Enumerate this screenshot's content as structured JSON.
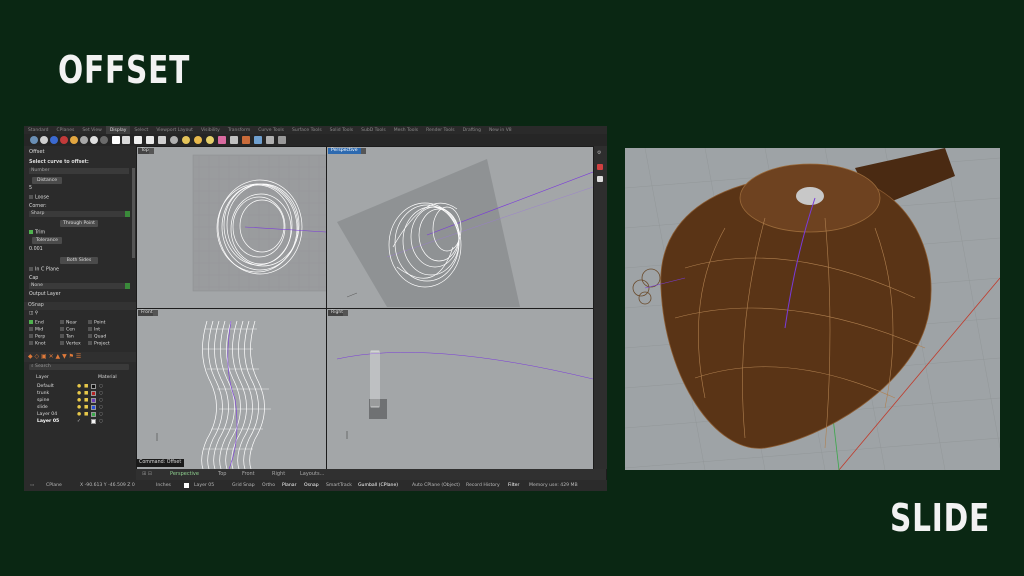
{
  "headings": {
    "offset": "OFFSET",
    "slide": "SLIDE"
  },
  "rhino": {
    "tabs": [
      "Standard",
      "CPlanes",
      "Set View",
      "Display",
      "Select",
      "Viewport Layout",
      "Visibility",
      "Transform",
      "Curve Tools",
      "Surface Tools",
      "Solid Tools",
      "SubD Tools",
      "Mesh Tools",
      "Render Tools",
      "Drafting",
      "New in V8"
    ],
    "active_tab": "Display",
    "command_panel": {
      "title": "Offset",
      "prompt": "Select curve to offset:",
      "number_placeholder": "Number",
      "distance_btn": "Distance",
      "distance_value": "5",
      "loose": "Loose",
      "corner_label": "Corner:",
      "corner_value": "Sharp",
      "through_point": "Through Point",
      "trim": "Trim",
      "tolerance_btn": "Tolerance",
      "tolerance_value": "0.001",
      "both_sides": "Both Sides",
      "in_cplane": "In C Plane",
      "cap_label": "Cap",
      "cap_value": "None",
      "output_layer": "Output Layer"
    },
    "osnap": {
      "title": "OSnap",
      "items": [
        {
          "label": "End",
          "on": true
        },
        {
          "label": "Near",
          "on": false
        },
        {
          "label": "Point",
          "on": false
        },
        {
          "label": "Mid",
          "on": false
        },
        {
          "label": "Cen",
          "on": false
        },
        {
          "label": "Int",
          "on": false
        },
        {
          "label": "Perp",
          "on": false
        },
        {
          "label": "Tan",
          "on": false
        },
        {
          "label": "Quad",
          "on": false
        },
        {
          "label": "Knot",
          "on": false
        },
        {
          "label": "Vertex",
          "on": false
        },
        {
          "label": "Project",
          "on": false
        }
      ]
    },
    "layers": {
      "search_placeholder": "Search",
      "col_layer": "Layer",
      "col_material": "Material",
      "rows": [
        {
          "name": "Default",
          "color": "#111111"
        },
        {
          "name": "trunk",
          "color": "#b22222"
        },
        {
          "name": "spine",
          "color": "#6a3ab8"
        },
        {
          "name": "slide",
          "color": "#2a4fd8"
        },
        {
          "name": "Layer 04",
          "color": "#3aa84a"
        },
        {
          "name": "Layer 05",
          "color": "#f5f5f5",
          "current": true
        }
      ]
    },
    "viewports": {
      "top": "Top",
      "perspective": "Perspective",
      "front": "Front",
      "right": "Right"
    },
    "command_line": "Command: Offset",
    "viewport_tabs": [
      "Perspective",
      "Top",
      "Front",
      "Right",
      "Layouts..."
    ],
    "status": {
      "cplane": "CPlane",
      "coords": "X -90.613 Y -46.509 Z 0",
      "units": "Inches",
      "layer": "Layer 05",
      "items": [
        "Grid Snap",
        "Ortho",
        "Planar",
        "Osnap",
        "SmartTrack",
        "Gumball (CPlane)",
        "Auto CPlane (Object)",
        "Record History",
        "Filter"
      ],
      "memory": "Memory use: 429 MB"
    }
  },
  "colors": {
    "background": "#0a2713",
    "viewport_bg": "#a3a6a8",
    "render_brown": "#5a3416",
    "active_label": "#2d6ab0"
  }
}
